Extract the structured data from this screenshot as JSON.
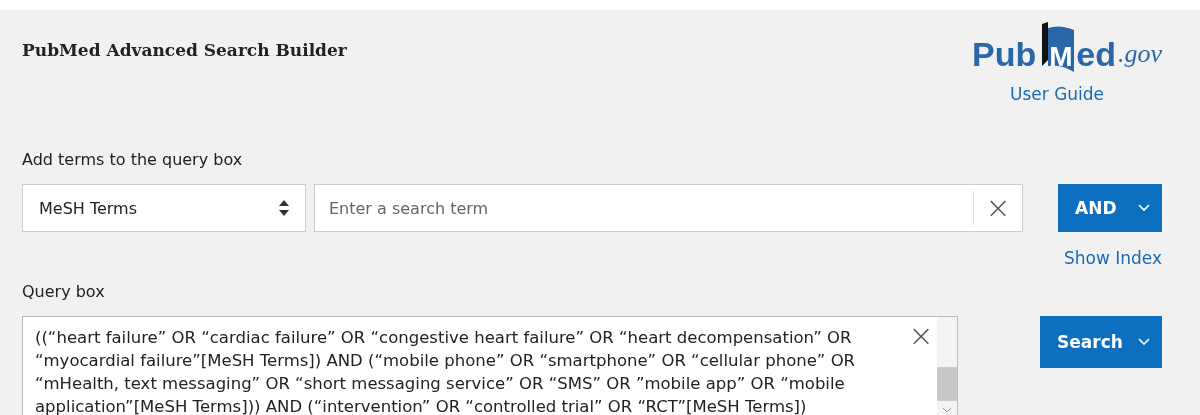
{
  "header": {
    "title": "PubMed Advanced Search Builder",
    "logo": {
      "part_1": "Pub",
      "part_2": "M",
      "part_3": "ed",
      "part_4": ".gov"
    },
    "user_guide": "User Guide"
  },
  "add_terms": {
    "label": "Add terms to the query box",
    "field_select": "MeSH Terms",
    "search": {
      "placeholder": "Enter a search term"
    },
    "clear_symbol": "×",
    "operator_button": "AND",
    "show_index": "Show Index"
  },
  "query_box": {
    "label": "Query box",
    "lines": [
      "((“heart failure” OR “cardiac failure” OR “congestive heart failure” OR “heart decompensation” OR",
      "“myocardial failure”[MeSH Terms]) AND (“mobile phone” OR “smartphone” OR “cellular phone” OR",
      "“mHealth, text messaging” OR “short messaging service” OR “SMS” OR ”mobile app” OR “mobile",
      "application”[MeSH Terms])) AND (“intervention” OR “controlled trial” OR “RCT”[MeSH Terms])"
    ],
    "clear_symbol": "×",
    "search_button": "Search"
  }
}
